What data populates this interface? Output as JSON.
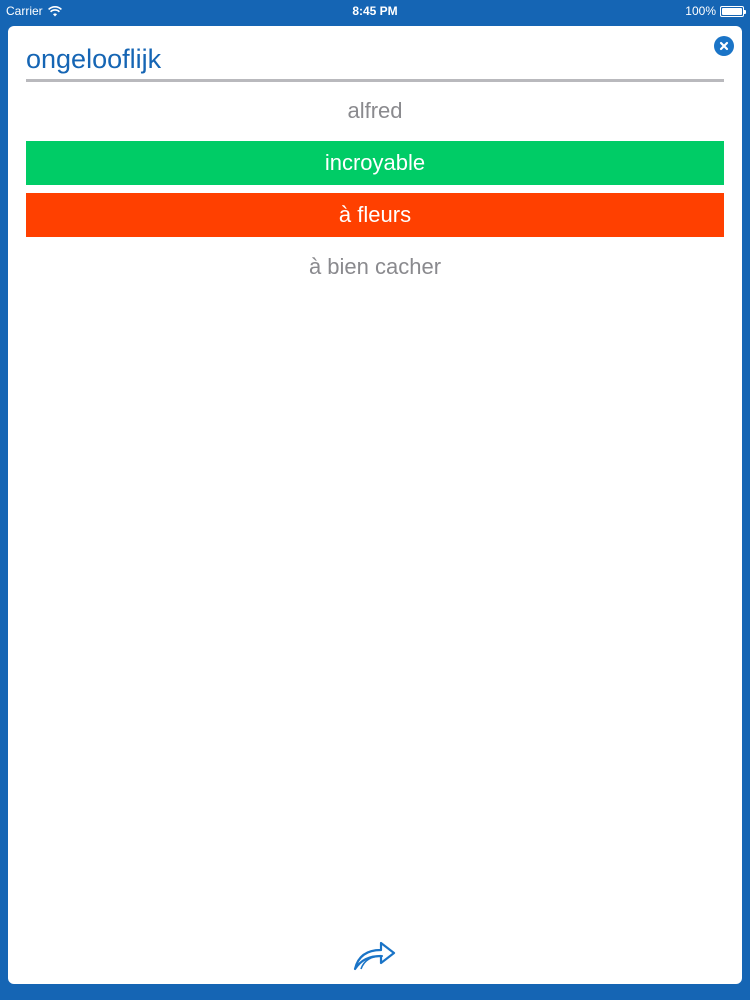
{
  "status_bar": {
    "carrier": "Carrier",
    "time": "8:45 PM",
    "battery": "100%",
    "battery_level": 1.0
  },
  "quiz": {
    "word": "ongelooflijk",
    "options": [
      {
        "label": "alfred",
        "state": "neutral"
      },
      {
        "label": "incroyable",
        "state": "correct"
      },
      {
        "label": "à fleurs",
        "state": "wrong"
      },
      {
        "label": "à bien cacher",
        "state": "neutral"
      }
    ]
  },
  "icons": {
    "close": "close-icon",
    "next": "forward-arrow-icon",
    "wifi": "wifi-icon"
  },
  "colors": {
    "background": "#1565b4",
    "title": "#1565b4",
    "correct": "#00cc66",
    "wrong": "#ff4000",
    "neutral_text": "#8a8a8e"
  }
}
